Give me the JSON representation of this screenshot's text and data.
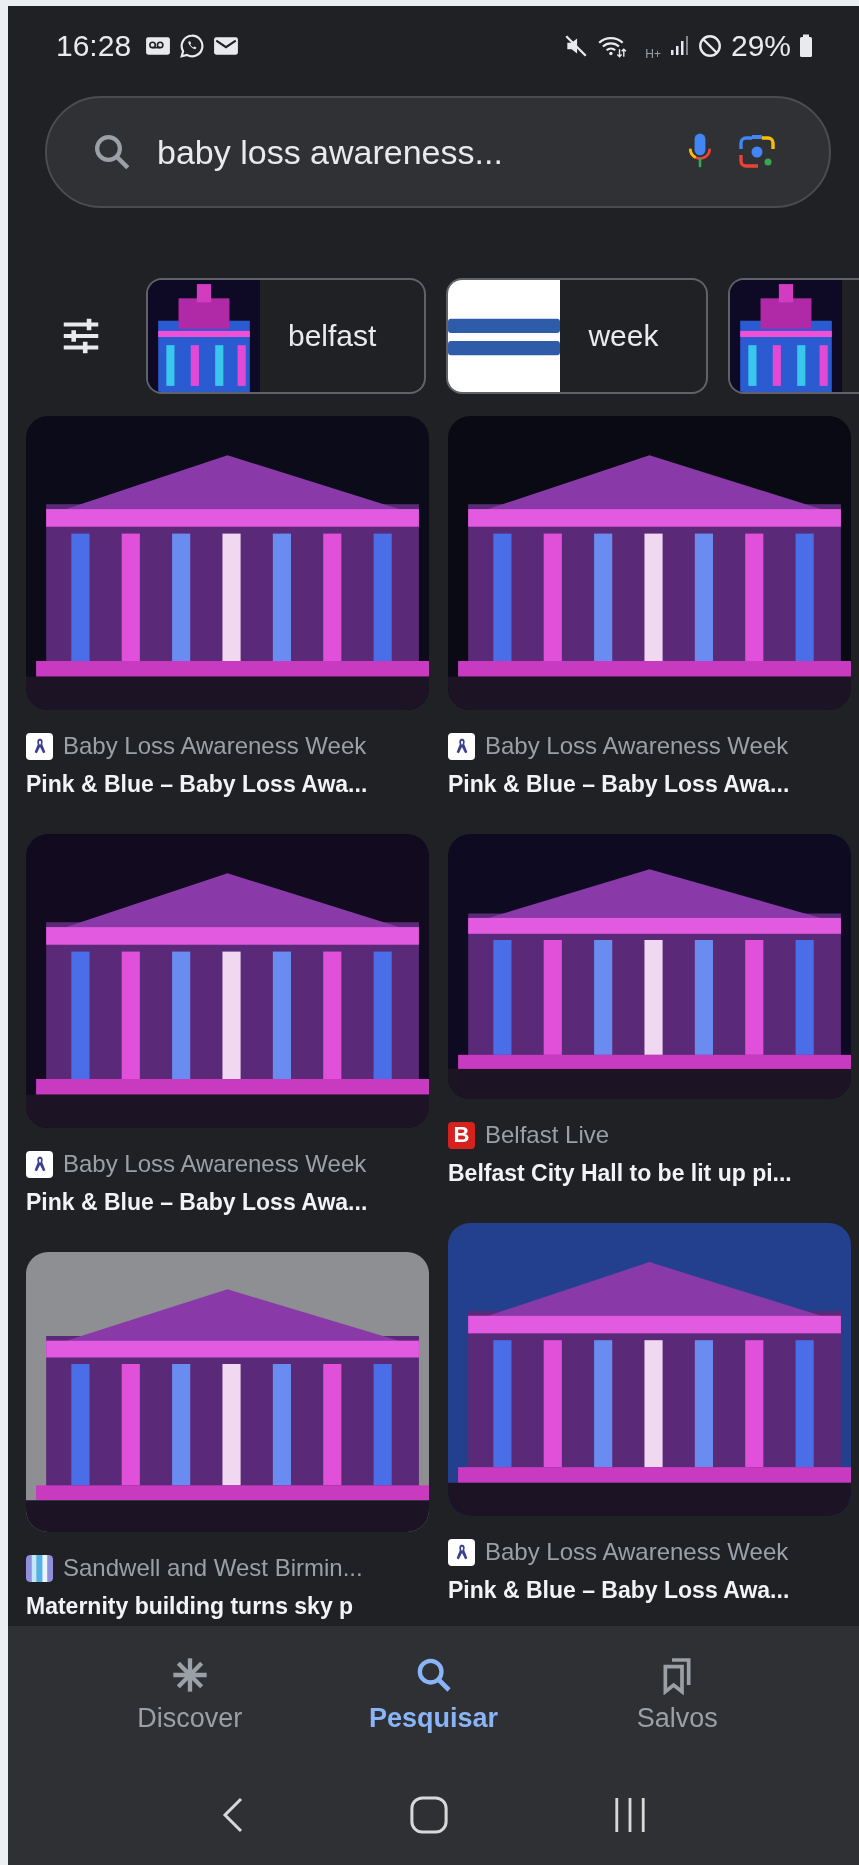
{
  "status_bar": {
    "time": "16:28",
    "network": "H+",
    "battery": "29%"
  },
  "search": {
    "value": "baby loss awareness..."
  },
  "chips": [
    {
      "kind": "picture",
      "label": "belfast"
    },
    {
      "kind": "picture",
      "label": "week"
    },
    {
      "kind": "picture"
    }
  ],
  "results": [
    [
      {
        "favicon": {
          "kind": "ribbon"
        },
        "source": "Baby Loss Awareness Week",
        "title": "Pink & Blue – Baby Loss Awa..."
      },
      {
        "favicon": {
          "kind": "ribbon"
        },
        "source": "Baby Loss Awareness Week",
        "title": "Pink & Blue – Baby Loss Awa..."
      },
      {
        "favicon": {
          "kind": "stripes"
        },
        "source": "Sandwell and West Birmin...",
        "title": "Maternity building turns sky p"
      }
    ],
    [
      {
        "favicon": {
          "kind": "ribbon"
        },
        "source": "Baby Loss Awareness Week",
        "title": "Pink & Blue – Baby Loss Awa..."
      },
      {
        "favicon": {
          "kind": "letter",
          "text": "B"
        },
        "source": "Belfast Live",
        "title": "Belfast City Hall to be lit up pi..."
      },
      {
        "favicon": {
          "kind": "ribbon"
        },
        "source": "Baby Loss Awareness Week",
        "title": "Pink & Blue – Baby Loss Awa..."
      }
    ]
  ],
  "bottom_nav": [
    {
      "label": "Discover",
      "selected": false
    },
    {
      "label": "Pesquisar",
      "selected": true
    },
    {
      "label": "Salvos",
      "selected": false
    }
  ]
}
